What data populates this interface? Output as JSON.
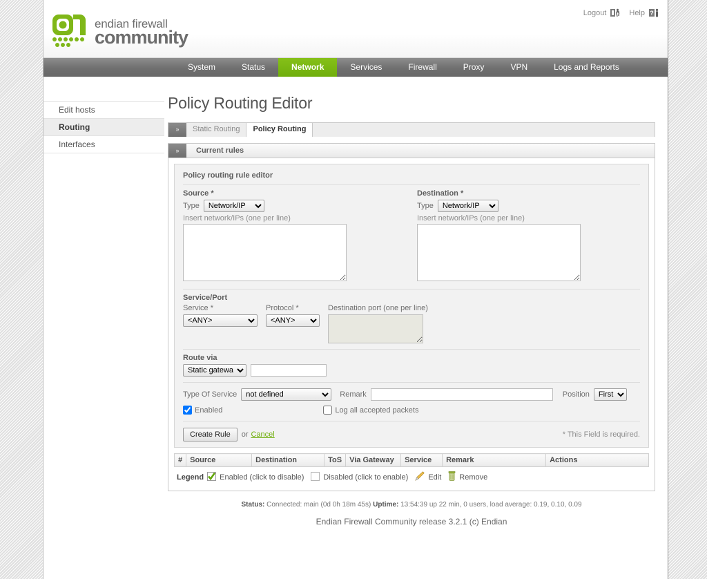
{
  "brand": {
    "line1": "endian firewall",
    "line2": "community",
    "logo_icon": "endian-logo-icon",
    "accent_green": "#7fb718",
    "nav_green": "#6fae0c"
  },
  "userbar": {
    "logout_label": "Logout",
    "logout_icon": "logout-door-icon",
    "help_label": "Help",
    "help_icon": "help-question-person-icon"
  },
  "mainnav": {
    "items": [
      {
        "label": "System",
        "active": false
      },
      {
        "label": "Status",
        "active": false
      },
      {
        "label": "Network",
        "active": true
      },
      {
        "label": "Services",
        "active": false
      },
      {
        "label": "Firewall",
        "active": false
      },
      {
        "label": "Proxy",
        "active": false
      },
      {
        "label": "VPN",
        "active": false
      },
      {
        "label": "Logs and Reports",
        "active": false
      }
    ]
  },
  "sidebar": {
    "items": [
      {
        "label": "Edit hosts",
        "active": false
      },
      {
        "label": "Routing",
        "active": true
      },
      {
        "label": "Interfaces",
        "active": false
      }
    ]
  },
  "page": {
    "title": "Policy Routing Editor"
  },
  "tabs": {
    "arrow_glyph": "»",
    "items": [
      {
        "label": "Static Routing",
        "active": false
      },
      {
        "label": "Policy Routing",
        "active": true
      }
    ]
  },
  "section": {
    "arrow_glyph": "»",
    "label": "Current rules"
  },
  "editor": {
    "title": "Policy routing rule editor",
    "source": {
      "group_label": "Source *",
      "type_label": "Type",
      "type_value": "Network/IP",
      "type_options": [
        "Network/IP"
      ],
      "hint": "Insert network/IPs (one per line)",
      "textarea_value": ""
    },
    "destination": {
      "group_label": "Destination *",
      "type_label": "Type",
      "type_value": "Network/IP",
      "type_options": [
        "Network/IP"
      ],
      "hint": "Insert network/IPs (one per line)",
      "textarea_value": ""
    },
    "service_port": {
      "group_label": "Service/Port",
      "service_label": "Service *",
      "service_value": "<ANY>",
      "service_options": [
        "<ANY>"
      ],
      "protocol_label": "Protocol *",
      "protocol_value": "<ANY>",
      "protocol_options": [
        "<ANY>"
      ],
      "dest_port_label": "Destination port (one per line)",
      "dest_port_value": ""
    },
    "route_via": {
      "group_label": "Route via",
      "select_value": "Static gateway",
      "select_options": [
        "Static gateway"
      ],
      "gateway_value": "",
      "gateway_placeholder": ""
    },
    "options": {
      "tos_label": "Type Of Service",
      "tos_value": "not defined",
      "tos_options": [
        "not defined"
      ],
      "remark_label": "Remark",
      "remark_value": "",
      "remark_placeholder": "",
      "position_label": "Position",
      "position_value": "First",
      "position_options": [
        "First"
      ],
      "enabled_label": "Enabled",
      "enabled_checked": true,
      "log_label": "Log all accepted packets",
      "log_checked": false
    },
    "submit": {
      "create_label": "Create Rule",
      "or_label": "or",
      "cancel_label": "Cancel",
      "required_note": "* This Field is required."
    }
  },
  "rules_table": {
    "columns": [
      "#",
      "Source",
      "Destination",
      "ToS",
      "Via Gateway",
      "Service",
      "Remark",
      "Actions"
    ],
    "rows": []
  },
  "legend": {
    "title": "Legend",
    "items": [
      {
        "icon": "enabled-check-icon",
        "label": "Enabled (click to disable)"
      },
      {
        "icon": "disabled-box-icon",
        "label": "Disabled (click to enable)"
      },
      {
        "icon": "edit-pencil-icon",
        "label": "Edit"
      },
      {
        "icon": "remove-trash-icon",
        "label": "Remove"
      }
    ]
  },
  "footer": {
    "status_label": "Status:",
    "status_value": "Connected: main (0d 0h 18m 45s)",
    "uptime_label": "Uptime:",
    "uptime_value": "13:54:39 up 22 min, 0 users, load average: 0.19, 0.10, 0.09",
    "release": "Endian Firewall Community release 3.2.1 (c) Endian"
  }
}
